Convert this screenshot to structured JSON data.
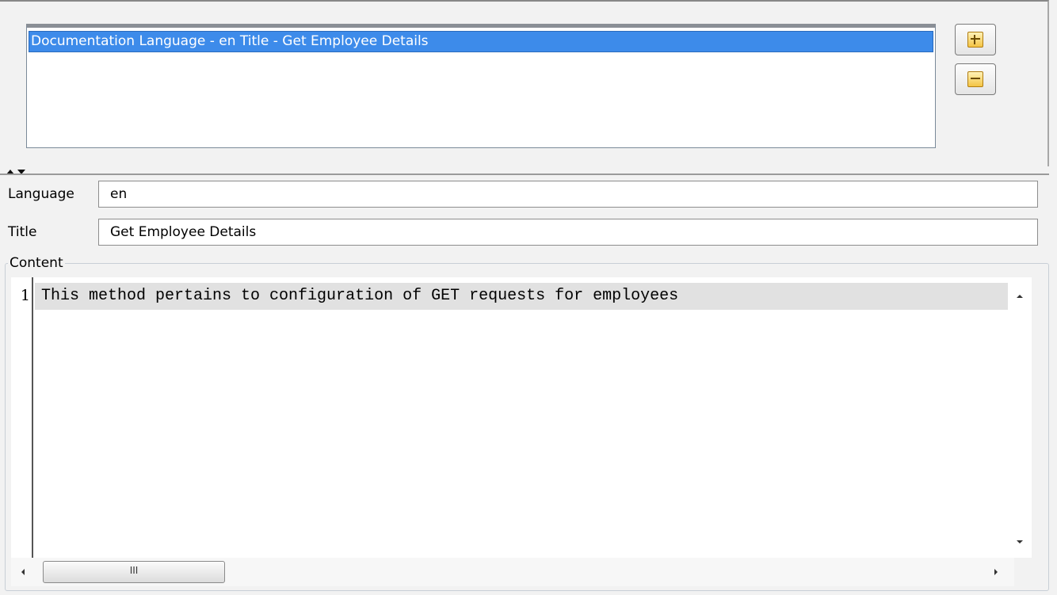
{
  "documentation": {
    "list_items": [
      "Documentation Language - en Title - Get Employee Details"
    ]
  },
  "form": {
    "language_label": "Language",
    "language_value": "en",
    "title_label": "Title",
    "title_value": "Get Employee Details",
    "content_label": "Content"
  },
  "editor": {
    "line_number": "1",
    "line_text": "This method pertains to configuration of GET requests for employees",
    "scroll_thumb_grip": "III"
  },
  "icons": {
    "add": "plus-icon",
    "remove": "minus-icon"
  },
  "colors": {
    "selection": "#3d8bea",
    "icon_fill": "#f4c444"
  }
}
